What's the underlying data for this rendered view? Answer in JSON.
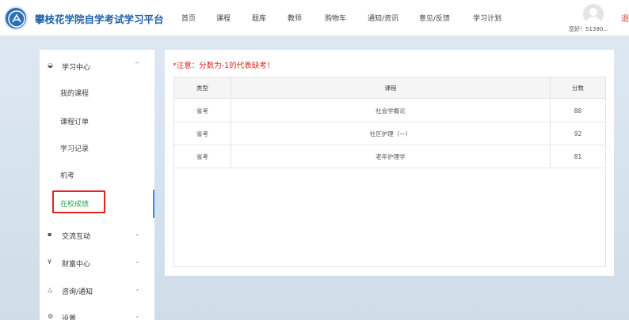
{
  "header": {
    "brand": "攀枝花学院自学考试学习平台",
    "nav": [
      "首页",
      "课程",
      "题库",
      "教师",
      "购物车",
      "通知/资讯",
      "意见/反馈",
      "学习计划"
    ],
    "greeting": "您好！51390...",
    "logout": "退"
  },
  "sidebar": {
    "learning_center": "学习中心",
    "sub_items": [
      "我的课程",
      "课程订单",
      "学习记录",
      "机考",
      "在校成绩"
    ],
    "groups": [
      "交流互动",
      "财富中心",
      "咨询/通知",
      "设置"
    ]
  },
  "main": {
    "notice": "*注意：分数为-1的代表缺考！",
    "table": {
      "headers": [
        "类型",
        "课程",
        "分数"
      ],
      "rows": [
        [
          "省考",
          "社会学概论",
          "88"
        ],
        [
          "省考",
          "社区护理（一）",
          "92"
        ],
        [
          "省考",
          "老年护理学",
          "81"
        ]
      ]
    }
  },
  "colors": {
    "brand": "#1f5fa8",
    "notice": "#e0261b",
    "active_item": "#2aa64a"
  }
}
